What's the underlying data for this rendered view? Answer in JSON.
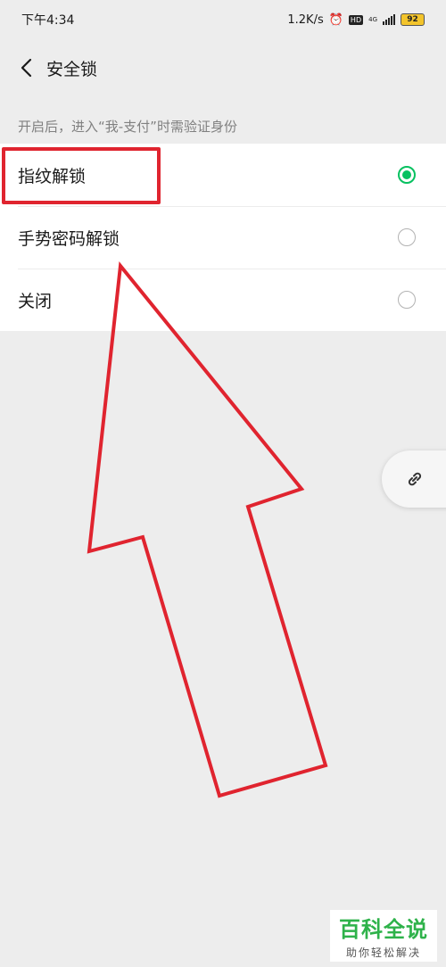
{
  "status_bar": {
    "time": "下午4:34",
    "net_speed": "1.2K/s",
    "hd": "HD",
    "network": "4G",
    "battery": "92"
  },
  "nav": {
    "title": "安全锁"
  },
  "hint": "开启后，进入“我-支付”时需验证身份",
  "options": [
    {
      "label": "指纹解锁",
      "selected": true
    },
    {
      "label": "手势密码解锁",
      "selected": false
    },
    {
      "label": "关闭",
      "selected": false
    }
  ],
  "watermark": {
    "main": "百科全说",
    "sub": "助你轻松解决"
  },
  "colors": {
    "accent": "#07c160",
    "annotation": "#e0242f",
    "watermark": "#2eb24a"
  }
}
